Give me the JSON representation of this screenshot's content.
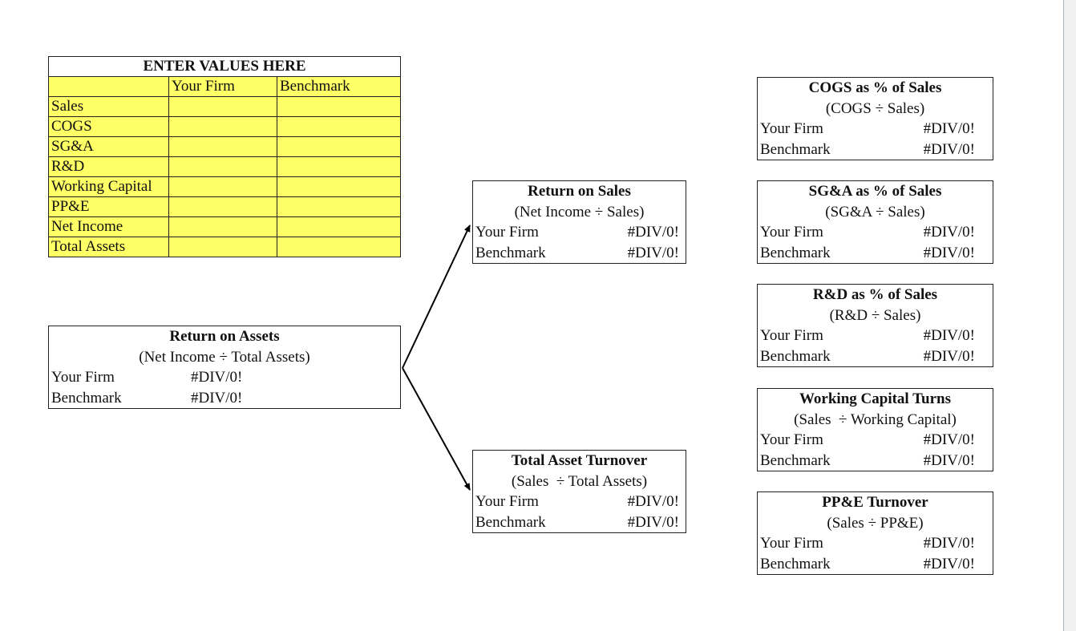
{
  "input_table": {
    "title": "ENTER VALUES HERE",
    "columns": [
      "",
      "Your Firm",
      "Benchmark"
    ],
    "rows": [
      {
        "label": "Sales",
        "your_firm": "",
        "benchmark": ""
      },
      {
        "label": "COGS",
        "your_firm": "",
        "benchmark": ""
      },
      {
        "label": "SG&A",
        "your_firm": "",
        "benchmark": ""
      },
      {
        "label": "R&D",
        "your_firm": "",
        "benchmark": ""
      },
      {
        "label": "Working Capital",
        "your_firm": "",
        "benchmark": ""
      },
      {
        "label": "PP&E",
        "your_firm": "",
        "benchmark": ""
      },
      {
        "label": "Net Income",
        "your_firm": "",
        "benchmark": ""
      },
      {
        "label": "Total Assets",
        "your_firm": "",
        "benchmark": ""
      }
    ],
    "fill_color": "#ffff66"
  },
  "ratios": {
    "roa": {
      "title": "Return on Assets",
      "formula": "(Net Income ÷ Total Assets)",
      "your_firm_label": "Your Firm",
      "your_firm_value": "#DIV/0!",
      "benchmark_label": "Benchmark",
      "benchmark_value": "#DIV/0!"
    },
    "ros": {
      "title": "Return on Sales",
      "formula": "(Net Income ÷ Sales)",
      "your_firm_label": "Your Firm",
      "your_firm_value": "#DIV/0!",
      "benchmark_label": "Benchmark",
      "benchmark_value": "#DIV/0!"
    },
    "tat": {
      "title": "Total Asset Turnover",
      "formula": "(Sales  ÷ Total Assets)",
      "your_firm_label": "Your Firm",
      "your_firm_value": "#DIV/0!",
      "benchmark_label": "Benchmark",
      "benchmark_value": "#DIV/0!"
    },
    "cogs": {
      "title": "COGS as % of Sales",
      "formula": "(COGS ÷ Sales)",
      "your_firm_label": "Your Firm",
      "your_firm_value": "#DIV/0!",
      "benchmark_label": "Benchmark",
      "benchmark_value": "#DIV/0!"
    },
    "sga": {
      "title": "SG&A as % of Sales",
      "formula": "(SG&A ÷ Sales)",
      "your_firm_label": "Your Firm",
      "your_firm_value": "#DIV/0!",
      "benchmark_label": "Benchmark",
      "benchmark_value": "#DIV/0!"
    },
    "rd": {
      "title": "R&D as % of Sales",
      "formula": "(R&D ÷ Sales)",
      "your_firm_label": "Your Firm",
      "your_firm_value": "#DIV/0!",
      "benchmark_label": "Benchmark",
      "benchmark_value": "#DIV/0!"
    },
    "wct": {
      "title": "Working Capital Turns",
      "formula": "(Sales  ÷ Working Capital)",
      "your_firm_label": "Your Firm",
      "your_firm_value": "#DIV/0!",
      "benchmark_label": "Benchmark",
      "benchmark_value": "#DIV/0!"
    },
    "ppe": {
      "title": "PP&E Turnover",
      "formula": "(Sales ÷ PP&E)",
      "your_firm_label": "Your Firm",
      "your_firm_value": "#DIV/0!",
      "benchmark_label": "Benchmark",
      "benchmark_value": "#DIV/0!"
    }
  }
}
